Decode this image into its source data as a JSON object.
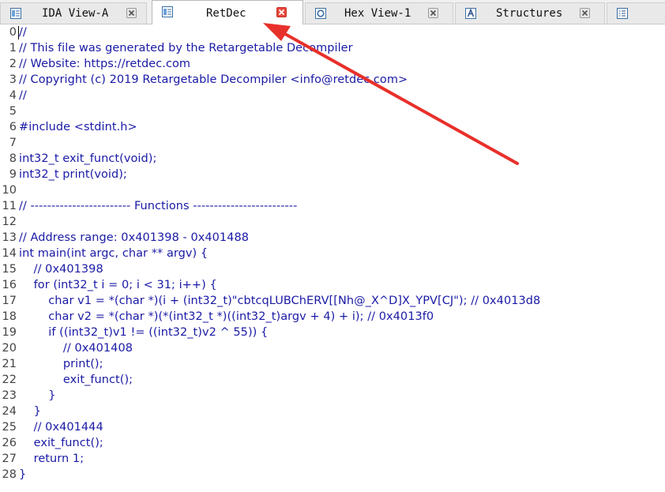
{
  "tabs": [
    {
      "label": "IDA View-A",
      "icon": "ida-view-icon",
      "active": false
    },
    {
      "label": "RetDec",
      "icon": "retdec-icon",
      "active": true
    },
    {
      "label": "Hex View-1",
      "icon": "hex-view-icon",
      "active": false
    },
    {
      "label": "Structures",
      "icon": "structures-icon",
      "active": false
    },
    {
      "label": "",
      "icon": "enums-icon",
      "active": false
    }
  ],
  "code_lines": [
    {
      "num": "0",
      "text": "//"
    },
    {
      "num": "1",
      "text": "// This file was generated by the Retargetable Decompiler"
    },
    {
      "num": "2",
      "text": "// Website: https://retdec.com"
    },
    {
      "num": "3",
      "text": "// Copyright (c) 2019 Retargetable Decompiler <info@retdec.com>"
    },
    {
      "num": "4",
      "text": "//"
    },
    {
      "num": "5",
      "text": ""
    },
    {
      "num": "6",
      "text": "#include <stdint.h>"
    },
    {
      "num": "7",
      "text": ""
    },
    {
      "num": "8",
      "text": "int32_t exit_funct(void);"
    },
    {
      "num": "9",
      "text": "int32_t print(void);"
    },
    {
      "num": "10",
      "text": ""
    },
    {
      "num": "11",
      "text": "// ------------------------ Functions -------------------------"
    },
    {
      "num": "12",
      "text": ""
    },
    {
      "num": "13",
      "text": "// Address range: 0x401398 - 0x401488"
    },
    {
      "num": "14",
      "text": "int main(int argc, char ** argv) {"
    },
    {
      "num": "15",
      "text": "    // 0x401398"
    },
    {
      "num": "16",
      "text": "    for (int32_t i = 0; i < 31; i++) {"
    },
    {
      "num": "17",
      "text": "        char v1 = *(char *)(i + (int32_t)\"cbtcqLUBChERV[[Nh@_X^D]X_YPV[CJ\"); // 0x4013d8"
    },
    {
      "num": "18",
      "text": "        char v2 = *(char *)(*(int32_t *)((int32_t)argv + 4) + i); // 0x4013f0"
    },
    {
      "num": "19",
      "text": "        if ((int32_t)v1 != ((int32_t)v2 ^ 55)) {"
    },
    {
      "num": "20",
      "text": "            // 0x401408"
    },
    {
      "num": "21",
      "text": "            print();"
    },
    {
      "num": "22",
      "text": "            exit_funct();"
    },
    {
      "num": "23",
      "text": "        }"
    },
    {
      "num": "24",
      "text": "    }"
    },
    {
      "num": "25",
      "text": "    // 0x401444"
    },
    {
      "num": "26",
      "text": "    exit_funct();"
    },
    {
      "num": "27",
      "text": "    return 1;"
    },
    {
      "num": "28",
      "text": "}"
    }
  ],
  "colors": {
    "code_text": "#1a1aa6",
    "line_number": "#444444",
    "annotation_arrow": "#e8302a",
    "active_close": "#e8483c"
  }
}
